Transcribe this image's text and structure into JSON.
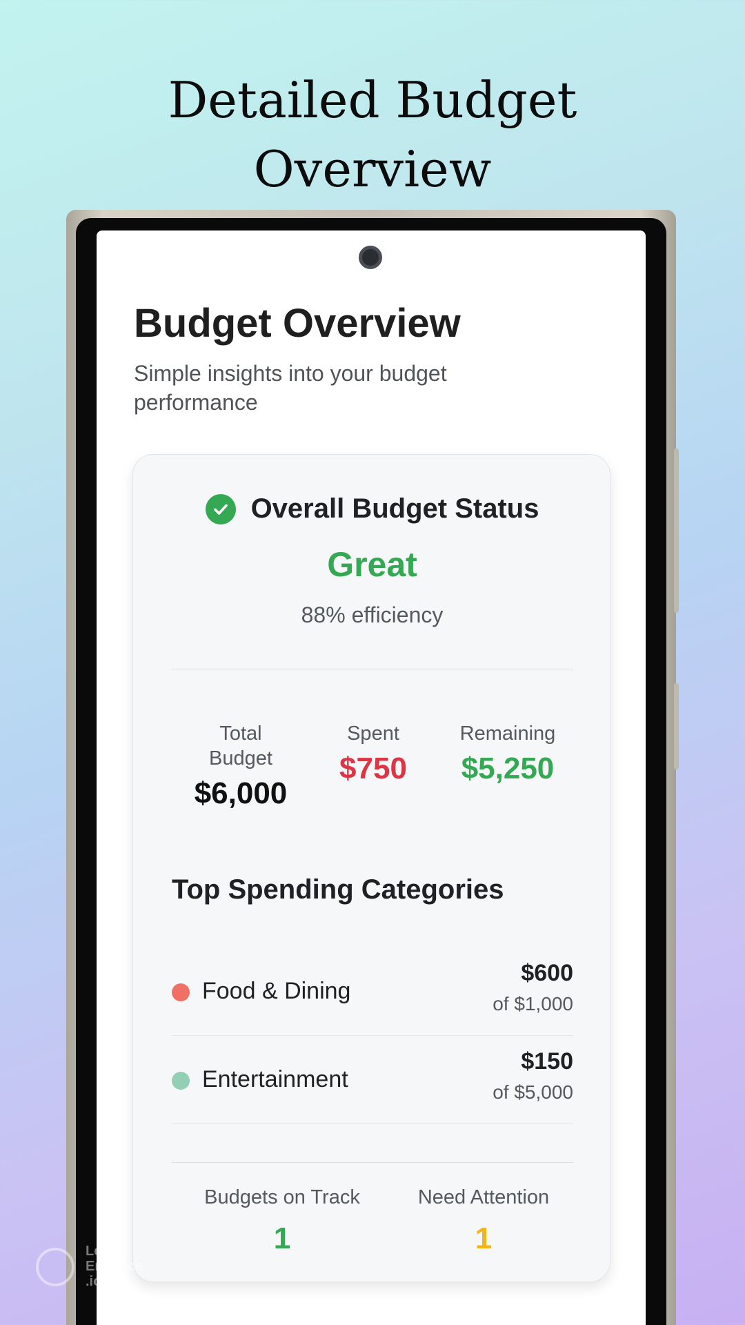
{
  "promo": {
    "title_line1": "Detailed Budget",
    "title_line2": "Overview"
  },
  "app": {
    "title": "Budget Overview",
    "subtitle": "Simple insights into your budget performance"
  },
  "status": {
    "label": "Overall Budget Status",
    "value": "Great",
    "efficiency": "88% efficiency",
    "icon": "check-circle-icon"
  },
  "stats": {
    "total_label": "Total Budget",
    "total_value": "$6,000",
    "spent_label": "Spent",
    "spent_value": "$750",
    "remaining_label": "Remaining",
    "remaining_value": "$5,250"
  },
  "categories": {
    "title": "Top Spending Categories",
    "items": [
      {
        "name": "Food & Dining",
        "amount": "$600",
        "limit": "of $1,000",
        "color": "#f07066"
      },
      {
        "name": "Entertainment",
        "amount": "$150",
        "limit": "of $5,000",
        "color": "#93cfb4"
      }
    ]
  },
  "summary": {
    "on_track_label": "Budgets on Track",
    "on_track_value": "1",
    "attention_label": "Need Attention",
    "attention_value": "1"
  },
  "colors": {
    "positive": "#34a853",
    "negative": "#dc3545",
    "warning": "#f5b416"
  },
  "watermark": {
    "text": "Let's Enhance .io"
  }
}
